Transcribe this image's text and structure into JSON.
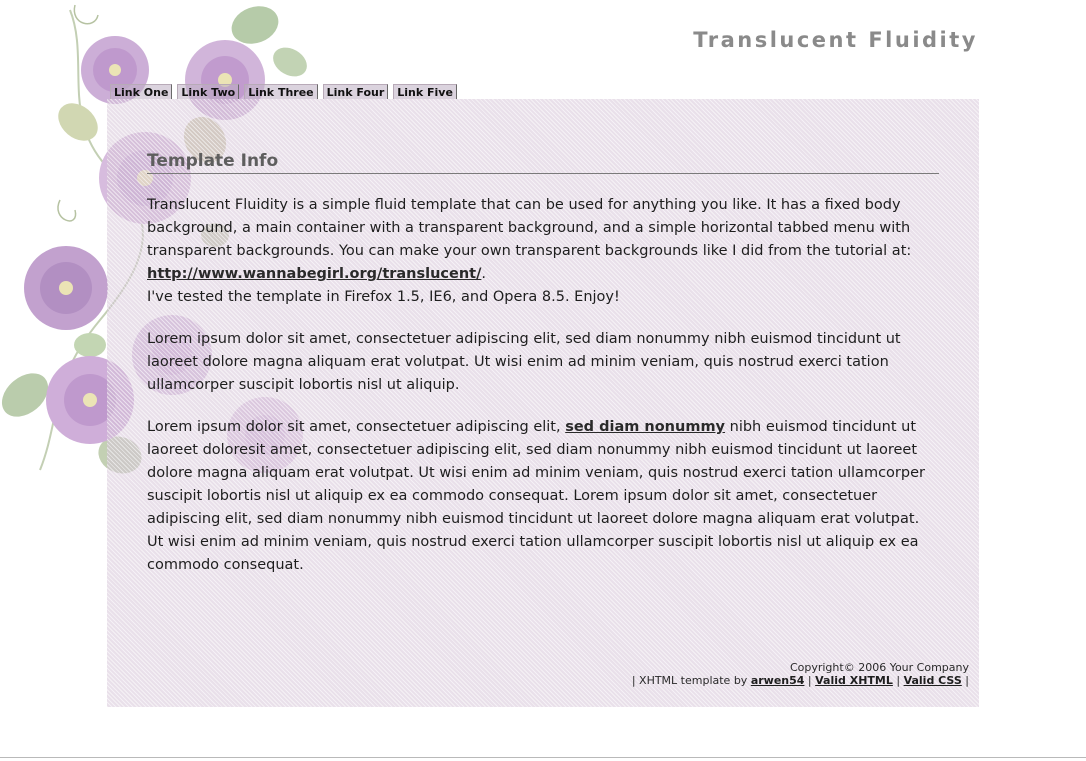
{
  "site": {
    "title": "Translucent Fluidity"
  },
  "nav": {
    "items": [
      "Link One",
      "Link Two",
      "Link Three",
      "Link Four",
      "Link Five"
    ]
  },
  "content": {
    "heading": "Template Info",
    "intro": {
      "text_before_link": "Translucent Fluidity is a simple fluid template that can be used for anything you like. It has a fixed body background, a main container with a transparent background, and a simple horizontal tabbed menu with transparent backgrounds. You can make your own transparent backgrounds like I did from the tutorial at: ",
      "link": "http://www.wannabegirl.org/translucent/",
      "after_link": ".",
      "second_line": "I've tested the template in Firefox 1.5, IE6, and Opera 8.5. Enjoy!"
    },
    "para2": "Lorem ipsum dolor sit amet, consectetuer adipiscing elit, sed diam nonummy nibh euismod tincidunt ut laoreet dolore magna aliquam erat volutpat. Ut wisi enim ad minim veniam, quis nostrud exerci tation ullamcorper suscipit lobortis nisl ut aliquip.",
    "para3": {
      "before_link": "Lorem ipsum dolor sit amet, consectetuer adipiscing elit, ",
      "link": "sed diam nonummy",
      "after_link": " nibh euismod tincidunt ut laoreet doloresit amet, consectetuer adipiscing elit, sed diam nonummy nibh euismod tincidunt ut laoreet dolore magna aliquam erat volutpat. Ut wisi enim ad minim veniam, quis nostrud exerci tation ullamcorper suscipit lobortis nisl ut aliquip ex ea commodo consequat. Lorem ipsum dolor sit amet, consectetuer adipiscing elit, sed diam nonummy nibh euismod tincidunt ut laoreet dolore magna aliquam erat volutpat. Ut wisi enim ad minim veniam, quis nostrud exerci tation ullamcorper suscipit lobortis nisl ut aliquip ex ea commodo consequat."
    }
  },
  "footer": {
    "copyright": "Copyright© 2006 Your Company",
    "prefix": "| XHTML template by ",
    "author_link": "arwen54",
    "sep1": " | ",
    "xhtml_link": "Valid XHTML",
    "sep2": " | ",
    "css_link": "Valid CSS",
    "suffix": " |"
  },
  "colors": {
    "title": "#8a8a8a",
    "container": "#d4c4d6",
    "flower": "#b58cc4",
    "leaf": "#a9c29a"
  },
  "decor": {
    "background": "floral-vine-illustration"
  }
}
